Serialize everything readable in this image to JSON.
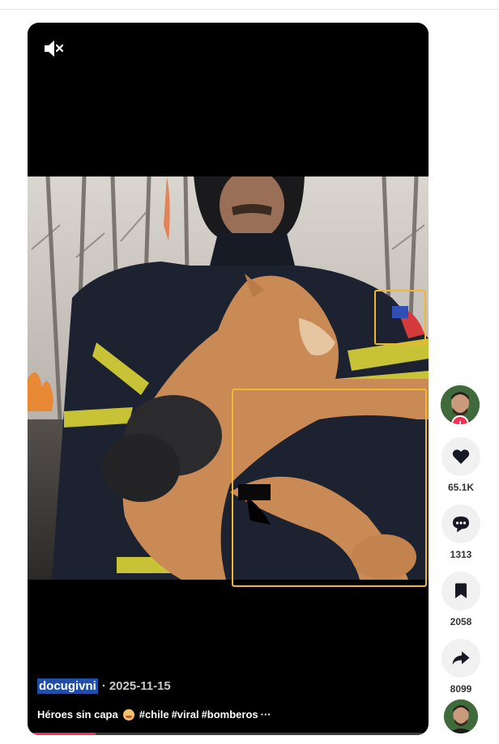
{
  "video": {
    "author": "docugivni",
    "separator": "·",
    "date": "2025-11-15",
    "caption_text": "Héroes sin capa",
    "emoji": "face-emoji",
    "hashtags": [
      "#chile",
      "#viral",
      "#bomberos"
    ],
    "ellipsis": "···",
    "progress": 0.17,
    "muted": true
  },
  "actions": {
    "likes": "65.1K",
    "comments": "1313",
    "bookmarks": "2058",
    "shares": "8099"
  },
  "icons": {
    "mute": "speaker-muted-icon",
    "like": "heart-icon",
    "comment": "comment-bubble-icon",
    "bookmark": "bookmark-icon",
    "share": "share-arrow-icon",
    "follow": "plus-icon"
  },
  "colors": {
    "accent": "#fe2c55",
    "highlight_box": "#f2b632",
    "author_highlight": "#1f4fa8"
  }
}
